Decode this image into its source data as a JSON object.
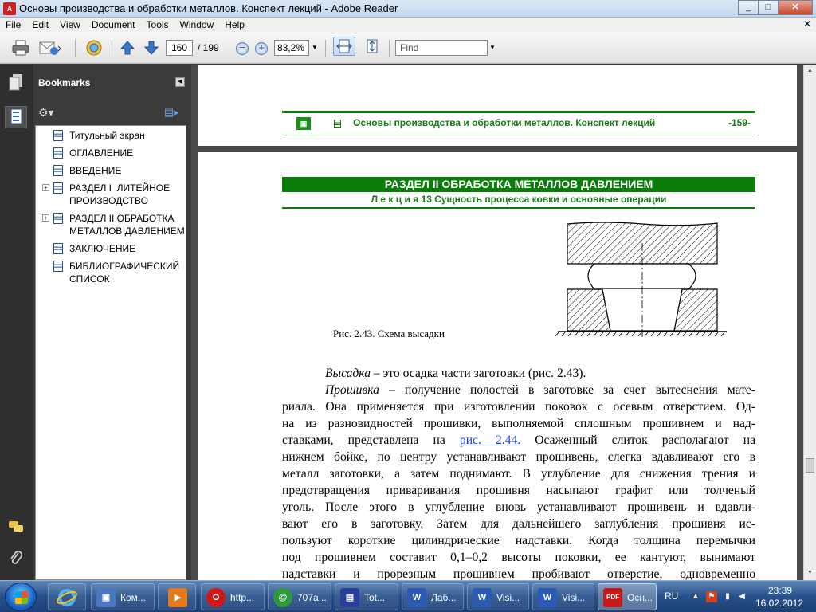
{
  "window": {
    "title": "Основы производства и обработки металлов. Конспект лекций - Adobe Reader",
    "app_icon": "adobe-reader-icon",
    "app_icon_glyph": "A",
    "minimize": "_",
    "maximize": "□",
    "close": "✕"
  },
  "menu": {
    "items": [
      "File",
      "Edit",
      "View",
      "Document",
      "Tools",
      "Window",
      "Help"
    ],
    "close_doc": "✕"
  },
  "toolbar": {
    "page_current": "160",
    "page_total": "/ 199",
    "zoom_out": "−",
    "zoom_in": "+",
    "zoom": "83,2%",
    "dropdown": "▼",
    "find_placeholder": "Find"
  },
  "bookmarks": {
    "header": "Bookmarks",
    "items": [
      {
        "label": "Титульный экран",
        "expandable": false
      },
      {
        "label": "ОГЛАВЛЕНИЕ",
        "expandable": false
      },
      {
        "label": "ВВЕДЕНИЕ",
        "expandable": false
      },
      {
        "label": "РАЗДЕЛ I  ЛИТЕЙНОЕ\nПРОИЗВОДСТВО",
        "expandable": true
      },
      {
        "label": "РАЗДЕЛ II ОБРАБОТКА\nМЕТАЛЛОВ ДАВЛЕНИЕМ",
        "expandable": true
      },
      {
        "label": "ЗАКЛЮЧЕНИЕ",
        "expandable": false
      },
      {
        "label": "БИБЛИОГРАФИЧЕСКИЙ\nСПИСОК",
        "expandable": false
      }
    ],
    "plus": "+"
  },
  "document": {
    "header_title": "Основы производства и обработки металлов. Конспект лекций",
    "header_page": "-159-",
    "section_title": "РАЗДЕЛ II  ОБРАБОТКА МЕТАЛЛОВ ДАВЛЕНИЕМ",
    "lecture_prefix": "Л е к ц и я",
    "lecture_title": " 13 Сущность процесса ковки и основные операции",
    "figure_caption": "Рис. 2.43. Схема высадки",
    "p1_term": "Высадка",
    "p1_text": " – это осадка части заготовки (рис. 2.43).",
    "p2_term": "Прошивка",
    "p2_line1_rest": " – получение полостей в заготовке за счет вытеснения мате-",
    "lines": [
      "риала. Она применяется при изготовлении поковок с осевым отверстием. Од-",
      "на из разновидностей прошивки, выполняемой сплошным прошивнем и над-"
    ],
    "line_link_before": "ставками, представлена на ",
    "line_link": "рис. 2.44.",
    "line_link_after": " Осаженный слиток располагают на",
    "lines2": [
      "нижнем бойке, по центру устанавливают прошивень, слегка вдавливают его в",
      "металл заготовки, а затем поднимают. В углубление для снижения трения и",
      "предотвращения приваривания прошивня насыпают графит или толченый",
      "уголь. После этого в углубление вновь устанавливают прошивень и вдавли-",
      "вают его в заготовку. Затем для дальнейшего заглубления прошивня ис-",
      "пользуют короткие цилиндрические надставки. Когда толщина перемычки",
      "под прошивнем составит 0,1–0,2 высоты поковки, ее кантуют, вынимают",
      "надставки и прорезным прошивнем пробивают отверстие, одновременно"
    ]
  },
  "taskbar": {
    "items": [
      {
        "label": "Ком...",
        "icon": "computer-icon",
        "glyph": "▣",
        "color": "#4a78c0"
      },
      {
        "label": "",
        "icon": "media-player-icon",
        "glyph": "▶",
        "color": "#e07a1a"
      },
      {
        "label": "http...",
        "icon": "opera-icon",
        "glyph": "O",
        "color": "#d01818"
      },
      {
        "label": "707a...",
        "icon": "at-sign-icon",
        "glyph": "@",
        "color": "#2e9a3a"
      },
      {
        "label": "Tot...",
        "icon": "floppy-disk-icon",
        "glyph": "▤",
        "color": "#2a3f9a"
      },
      {
        "label": "Лаб...",
        "icon": "word-doc-icon",
        "glyph": "W",
        "color": "#2b5bb5"
      },
      {
        "label": "Visi...",
        "icon": "word-doc-icon",
        "glyph": "W",
        "color": "#2b5bb5"
      },
      {
        "label": "Visi...",
        "icon": "word-doc-icon",
        "glyph": "W",
        "color": "#2b5bb5"
      },
      {
        "label": "Осн...",
        "icon": "pdf-icon",
        "glyph": "PDF",
        "color": "#c41a1a"
      }
    ],
    "lang": "RU",
    "time": "23:39",
    "date": "16.02.2012"
  },
  "colors": {
    "green": "#0b7d0b",
    "link": "#1d3fcf"
  }
}
